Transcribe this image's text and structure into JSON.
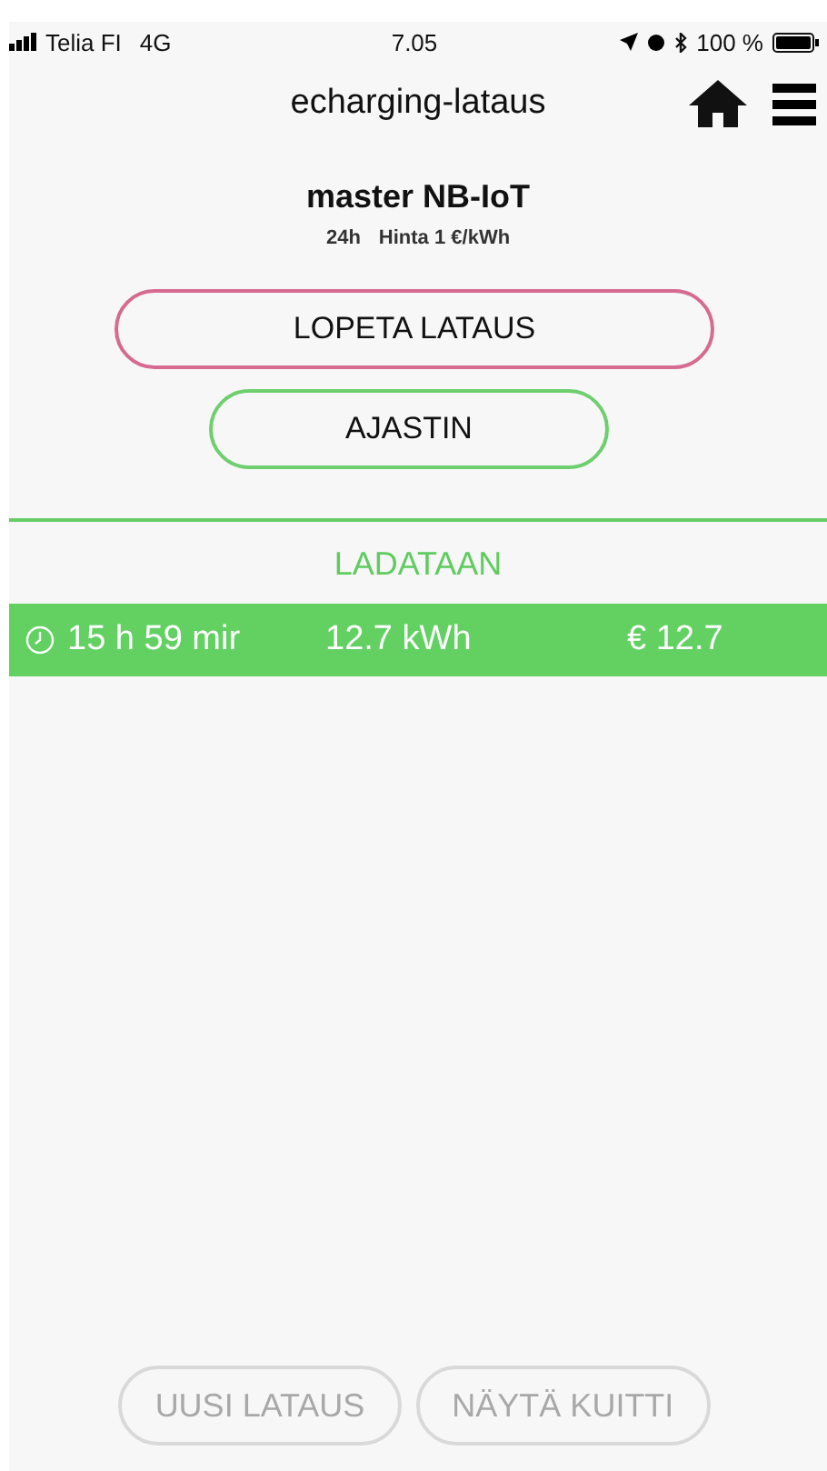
{
  "status_bar": {
    "carrier": "Telia FI",
    "network": "4G",
    "time": "7.05",
    "battery": "100 %"
  },
  "header": {
    "title": "echarging-lataus"
  },
  "device": {
    "name": "master NB-IoT",
    "period": "24h",
    "price": "Hinta 1 €/kWh"
  },
  "actions": [
    {
      "label": "LOPETA LATAUS",
      "kind": "stop"
    },
    {
      "label": "AJASTIN",
      "kind": "timer"
    }
  ],
  "session": {
    "status": "LADATAAN",
    "duration": "15 h 59 mir",
    "energy": "12.7 kWh",
    "cost": "€ 12.7"
  },
  "footer_buttons": [
    {
      "label": "UUSI LATAUS",
      "disabled": true
    },
    {
      "label": "NÄYTÄ KUITTI",
      "disabled": true
    }
  ]
}
